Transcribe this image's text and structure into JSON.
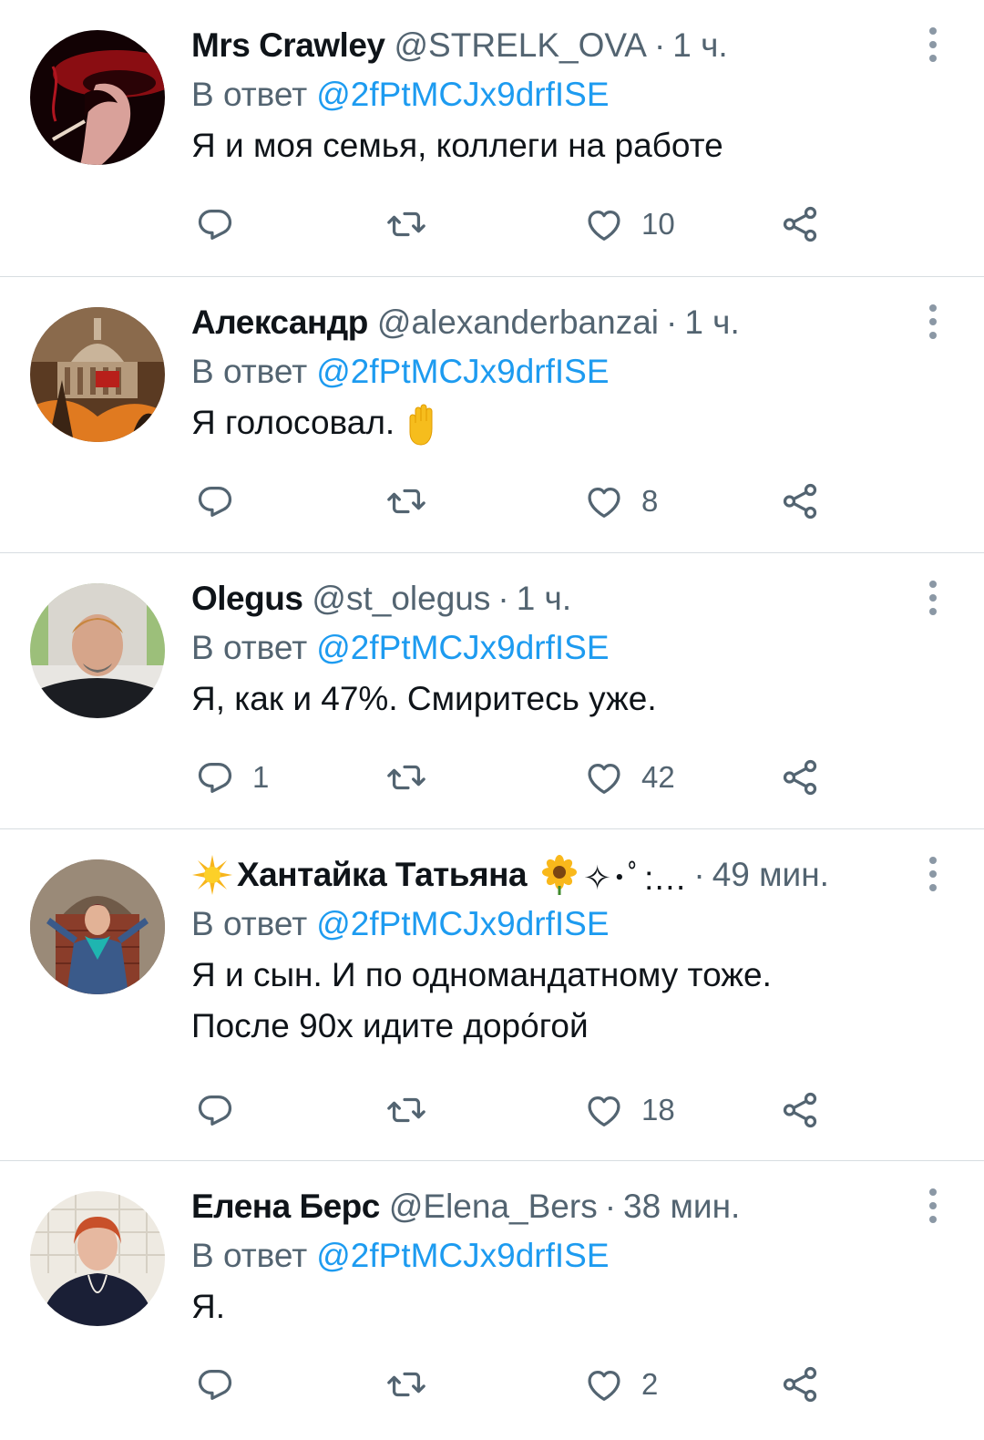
{
  "reply_prefix": "В ответ",
  "reply_to": "@2fPtMCJx9drfISE",
  "tweets": [
    {
      "name": "Mrs Crawley",
      "handle": "@STRELK_OVA",
      "time": "1 ч.",
      "text": [
        "Я и моя семья, коллеги на работе"
      ],
      "replies": "",
      "retweets": "",
      "likes": "10"
    },
    {
      "name": "Александр",
      "handle": "@alexanderbanzai",
      "time": "1 ч.",
      "text": [
        "Я голосовал."
      ],
      "emoji": "raised-hand",
      "replies": "",
      "retweets": "",
      "likes": "8"
    },
    {
      "name": "Olegus",
      "handle": "@st_olegus",
      "time": "1 ч.",
      "text": [
        "Я, как и 47%. Смиритесь уже."
      ],
      "replies": "1",
      "retweets": "",
      "likes": "42"
    },
    {
      "name": "Хантайка Татьяна",
      "name_suffix": "✧･ﾟ:…",
      "handle": "",
      "time": "49 мин.",
      "text": [
        "Я и сын. И по одномандатному тоже.",
        "После 90х идите доро́гой"
      ],
      "replies": "",
      "retweets": "",
      "likes": "18"
    },
    {
      "name": "Елена Берс",
      "handle": "@Elena_Bers",
      "time": "38 мин.",
      "text": [
        "Я."
      ],
      "replies": "",
      "retweets": "",
      "likes": "2"
    }
  ],
  "colors": {
    "accent": "#1d9bf0",
    "secondary_text": "#536471",
    "divider": "#d7dde1"
  },
  "icons": [
    "reply-icon",
    "retweet-icon",
    "like-icon",
    "share-icon",
    "more-icon",
    "sun-emoji-icon",
    "sunflower-emoji-icon",
    "raised-hand-emoji-icon"
  ]
}
